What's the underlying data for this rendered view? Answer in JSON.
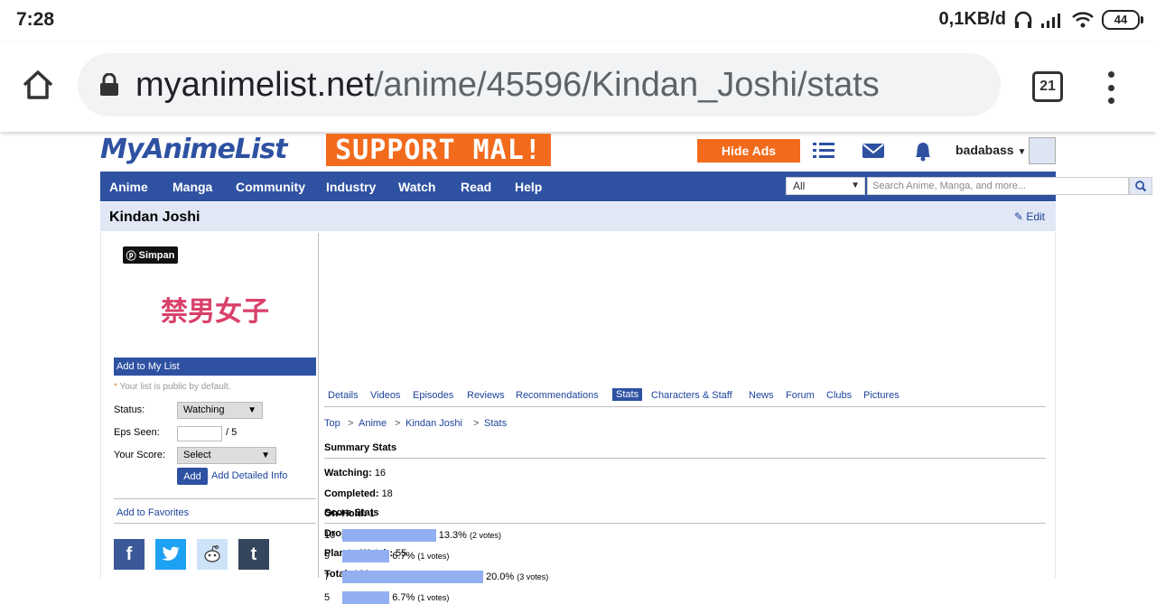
{
  "status_bar": {
    "time": "7:28",
    "speed": "0,1KB/d",
    "battery": "44"
  },
  "browser": {
    "url_host": "myanimelist.net",
    "url_path": "/anime/45596/Kindan_Joshi/stats",
    "tab_count": "21"
  },
  "header": {
    "logo": "MyAnimeList",
    "support": "SUPPORT MAL!",
    "hide_ads": "Hide Ads",
    "username": "badabass"
  },
  "nav": {
    "items": [
      "Anime",
      "Manga",
      "Community",
      "Industry",
      "Watch",
      "Read",
      "Help"
    ],
    "search_type": "All",
    "search_placeholder": "Search Anime, Manga, and more..."
  },
  "page": {
    "title": "Kindan Joshi",
    "edit": "Edit"
  },
  "sidebar": {
    "simpan": "Simpan",
    "poster_text": "禁男女子",
    "add_to_list": "Add to My List",
    "public_note": "Your list is public by default.",
    "status_label": "Status:",
    "status_value": "Watching",
    "eps_label": "Eps Seen:",
    "eps_total": "/ 5",
    "score_label": "Your Score:",
    "score_value": "Select",
    "add_button": "Add",
    "add_detailed": "Add Detailed Info",
    "add_favorites": "Add to Favorites"
  },
  "tabs": [
    "Details",
    "Videos",
    "Episodes",
    "Reviews",
    "Recommendations",
    "Stats",
    "Characters & Staff",
    "News",
    "Forum",
    "Clubs",
    "Pictures"
  ],
  "active_tab": "Stats",
  "breadcrumb": [
    "Top",
    "Anime",
    "Kindan Joshi",
    "Stats"
  ],
  "summary": {
    "heading": "Summary Stats",
    "rows": [
      {
        "label": "Watching:",
        "value": "16"
      },
      {
        "label": "Completed:",
        "value": "18"
      },
      {
        "label": "On-Hold:",
        "value": "1"
      },
      {
        "label": "Dropped:",
        "value": "10"
      },
      {
        "label": "Plan to Watch:",
        "value": "55"
      },
      {
        "label": "Total:",
        "value": "100"
      }
    ]
  },
  "score_stats": {
    "heading": "Score Stats",
    "rows": [
      {
        "score": "10",
        "percent": 13.3,
        "pct_text": "13.3%",
        "votes": "(2 votes)"
      },
      {
        "score": "9",
        "percent": 6.7,
        "pct_text": "6.7%",
        "votes": "(1 votes)"
      },
      {
        "score": "7",
        "percent": 20.0,
        "pct_text": "20.0%",
        "votes": "(3 votes)"
      },
      {
        "score": "5",
        "percent": 6.7,
        "pct_text": "6.7%",
        "votes": "(1 votes)"
      }
    ]
  },
  "colors": {
    "mal_blue": "#2e51a2",
    "orange": "#f26b1d",
    "bar": "#92b0f1",
    "link": "#1c439b"
  }
}
